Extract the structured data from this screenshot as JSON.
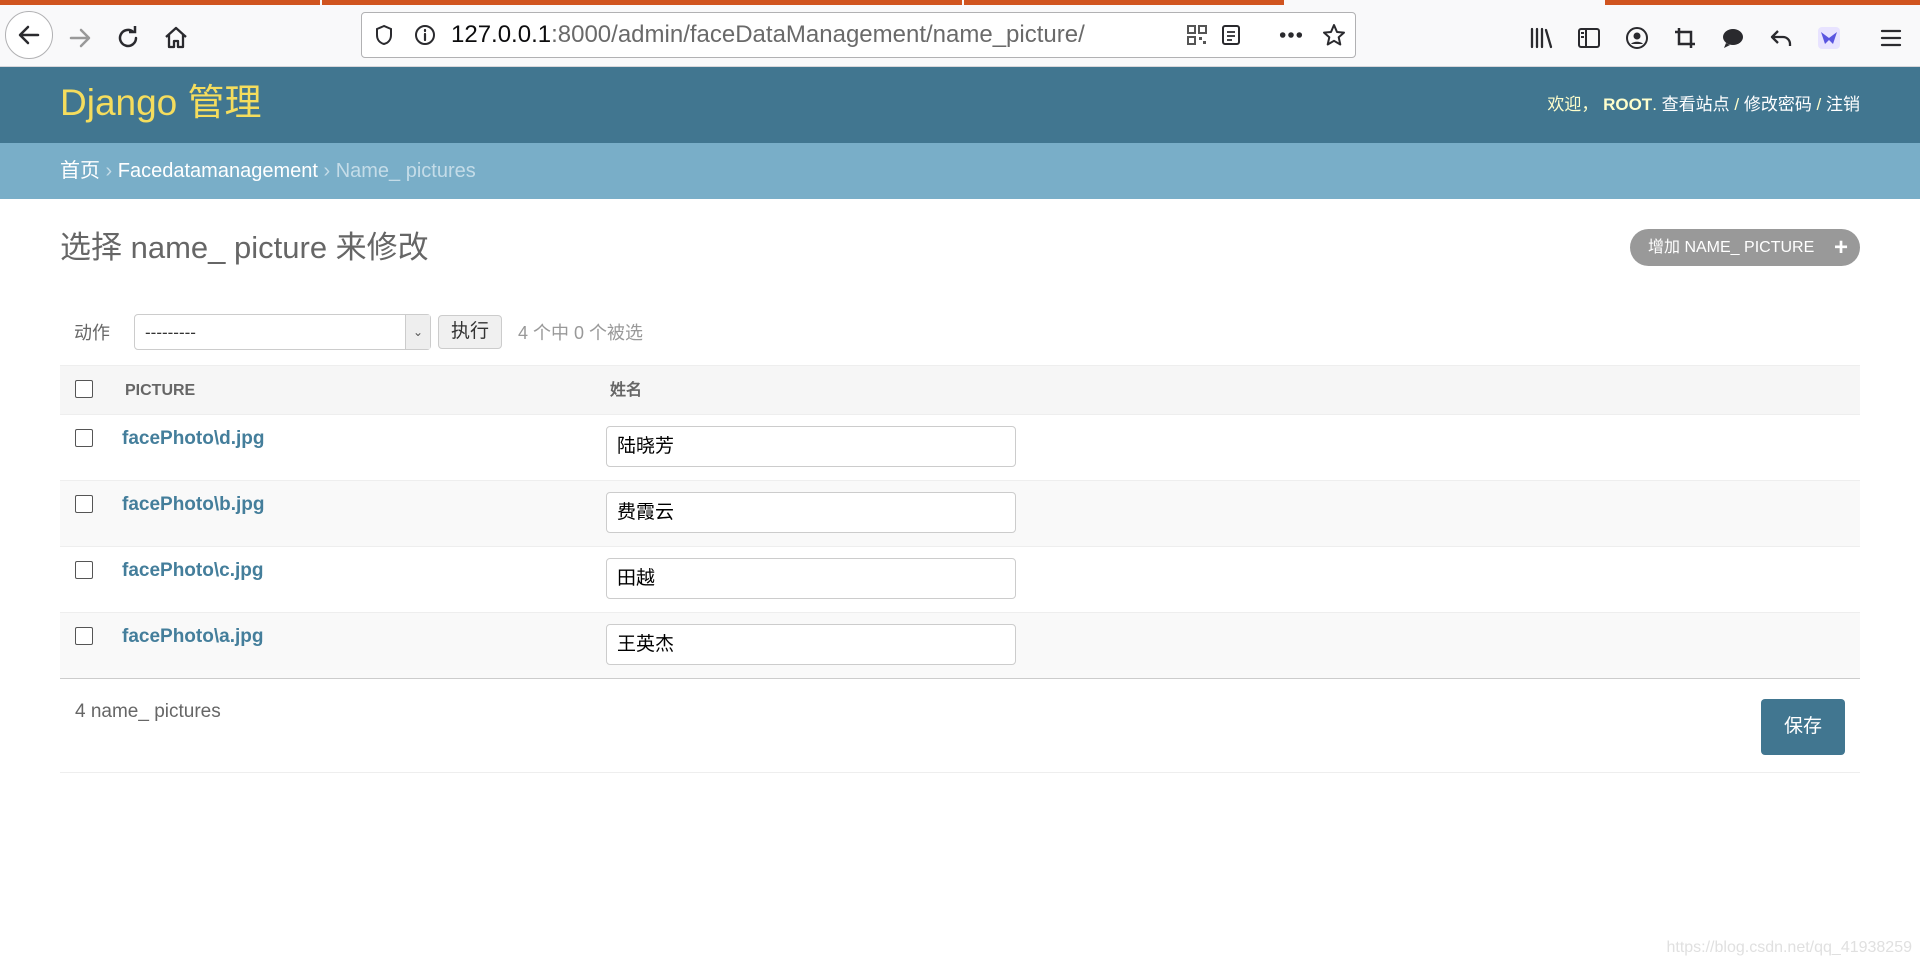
{
  "browser": {
    "url_host": "127.0.0.1",
    "url_rest": ":8000/admin/faceDataManagement/name_picture/"
  },
  "header": {
    "brand": "Django 管理",
    "welcome": "欢迎，",
    "username": "ROOT",
    "view_site": "查看站点",
    "change_password": "修改密码",
    "logout": "注销",
    "sep": " / "
  },
  "breadcrumbs": {
    "home": "首页",
    "app": "Facedatamanagement",
    "current": "Name_ pictures",
    "sep": " › "
  },
  "content": {
    "title": "选择 name_ picture 来修改",
    "add_button": "增加 NAME_ PICTURE"
  },
  "actions": {
    "label": "动作",
    "selected_option": "---------",
    "go_button": "执行",
    "counter": "4 个中 0 个被选"
  },
  "table": {
    "headers": [
      "PICTURE",
      "姓名"
    ],
    "rows": [
      {
        "picture": "facePhoto\\d.jpg",
        "name": "陆晓芳"
      },
      {
        "picture": "facePhoto\\b.jpg",
        "name": "费霞云"
      },
      {
        "picture": "facePhoto\\c.jpg",
        "name": "田越"
      },
      {
        "picture": "facePhoto\\a.jpg",
        "name": "王英杰"
      }
    ]
  },
  "paginator": {
    "count": "4 name_ pictures",
    "save_button": "保存"
  },
  "watermark": "https://blog.csdn.net/qq_41938259",
  "colors": {
    "header_bg": "#417690",
    "brand": "#f5dd5d",
    "breadcrumbs_bg": "#79aec8",
    "link": "#447e9b",
    "tab_accent": "#d0541f"
  }
}
